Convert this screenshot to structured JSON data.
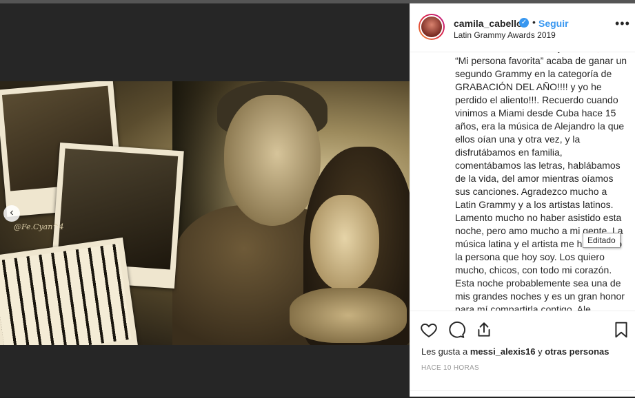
{
  "post": {
    "username": "camila_cabello",
    "follow_label": "Seguir",
    "separator": "•",
    "location": "Latin Grammy Awards 2019",
    "verified_glyph": "✓",
    "more_glyph": "•••"
  },
  "image": {
    "signature": "@Fe.Cyan^4",
    "prev_glyph": "‹"
  },
  "caption": {
    "text": "honor to share this with you Ale ❤️ //// “Mi persona favorita” acaba de ganar un segundo Grammy en la categoría de GRABACIÓN DEL AÑO!!!! y yo he perdido el aliento!!!. Recuerdo cuando vinimos a Miami desde Cuba hace 15 años, era la música de Alejandro la que ellos oían una y otra vez, y la disfrutábamos en familia, comentábamos las letras, hablábamos de la vida, del amor mientras oíamos sus canciones. Agradezco mucho a Latin Grammy y a los artistas latinos. Lamento mucho no haber asistido esta noche, pero amo mucho a mi gente. La música latina y el artista me han hecho la persona que hoy soy. Los quiero mucho, chicos, con todo mi corazón. Esta noche probablemente sea una de mis grandes noches y es un gran honor para mí compartirla contigo, Ale"
  },
  "tooltip": "Editado",
  "actions": {
    "likes_prefix": "Les gusta a ",
    "likes_user": "messi_alexis16",
    "likes_suffix": " y ",
    "likes_others": "otras personas",
    "time": "HACE 10 HORAS"
  },
  "icons": {
    "like": "heart-icon",
    "comment": "comment-icon",
    "share": "share-icon",
    "save": "bookmark-icon"
  }
}
